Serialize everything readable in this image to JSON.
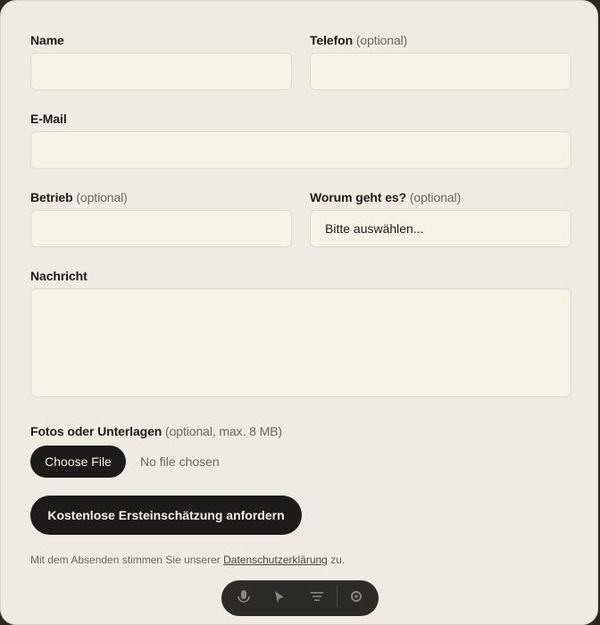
{
  "form": {
    "name": {
      "label": "Name",
      "value": ""
    },
    "phone": {
      "label": "Telefon",
      "optional": "(optional)",
      "value": ""
    },
    "email": {
      "label": "E-Mail",
      "value": ""
    },
    "company": {
      "label": "Betrieb",
      "optional": "(optional)",
      "value": ""
    },
    "topic": {
      "label": "Worum geht es?",
      "optional": "(optional)",
      "selected": "Bitte auswählen..."
    },
    "message": {
      "label": "Nachricht",
      "value": ""
    },
    "files": {
      "label": "Fotos oder Unterlagen",
      "optional": "(optional, max. 8 MB)",
      "button": "Choose File",
      "status": "No file chosen"
    },
    "submit": "Kostenlose Ersteinschätzung anfordern",
    "consent": {
      "prefix": "Mit dem Absenden stimmen Sie unserer",
      "link": "Datenschutzerklärung",
      "suffix": "zu."
    }
  },
  "dock": {
    "icons": [
      "microphone-icon",
      "pointer-icon",
      "menu-icon",
      "settings-icon"
    ]
  }
}
